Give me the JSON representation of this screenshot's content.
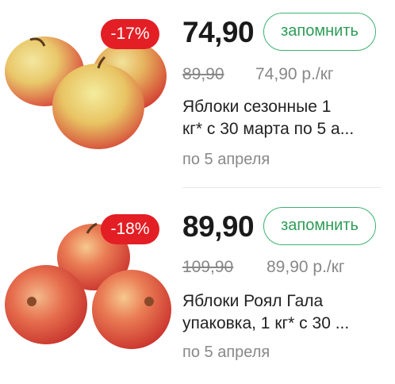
{
  "products": [
    {
      "discount": "-17%",
      "price": "74,90",
      "remember_label": "запомнить",
      "old_price": "89,90",
      "unit_price": "74,90 р./кг",
      "title_line1": "Яблоки сезонные 1",
      "title_line2": "кг* с 30 марта по 5 а...",
      "valid_until": "по 5 апреля",
      "image_icon": "apples-photo"
    },
    {
      "discount": "-18%",
      "price": "89,90",
      "remember_label": "запомнить",
      "old_price": "109,90",
      "unit_price": "89,90 р./кг",
      "title_line1": "Яблоки Роял Гала",
      "title_line2": "упаковка, 1 кг* с 30 ...",
      "valid_until": "по 5 апреля",
      "image_icon": "apples-photo"
    }
  ],
  "colors": {
    "badge": "#e31e24",
    "button_border": "#3cb371",
    "button_text": "#2e9c56",
    "muted_text": "#888888"
  }
}
